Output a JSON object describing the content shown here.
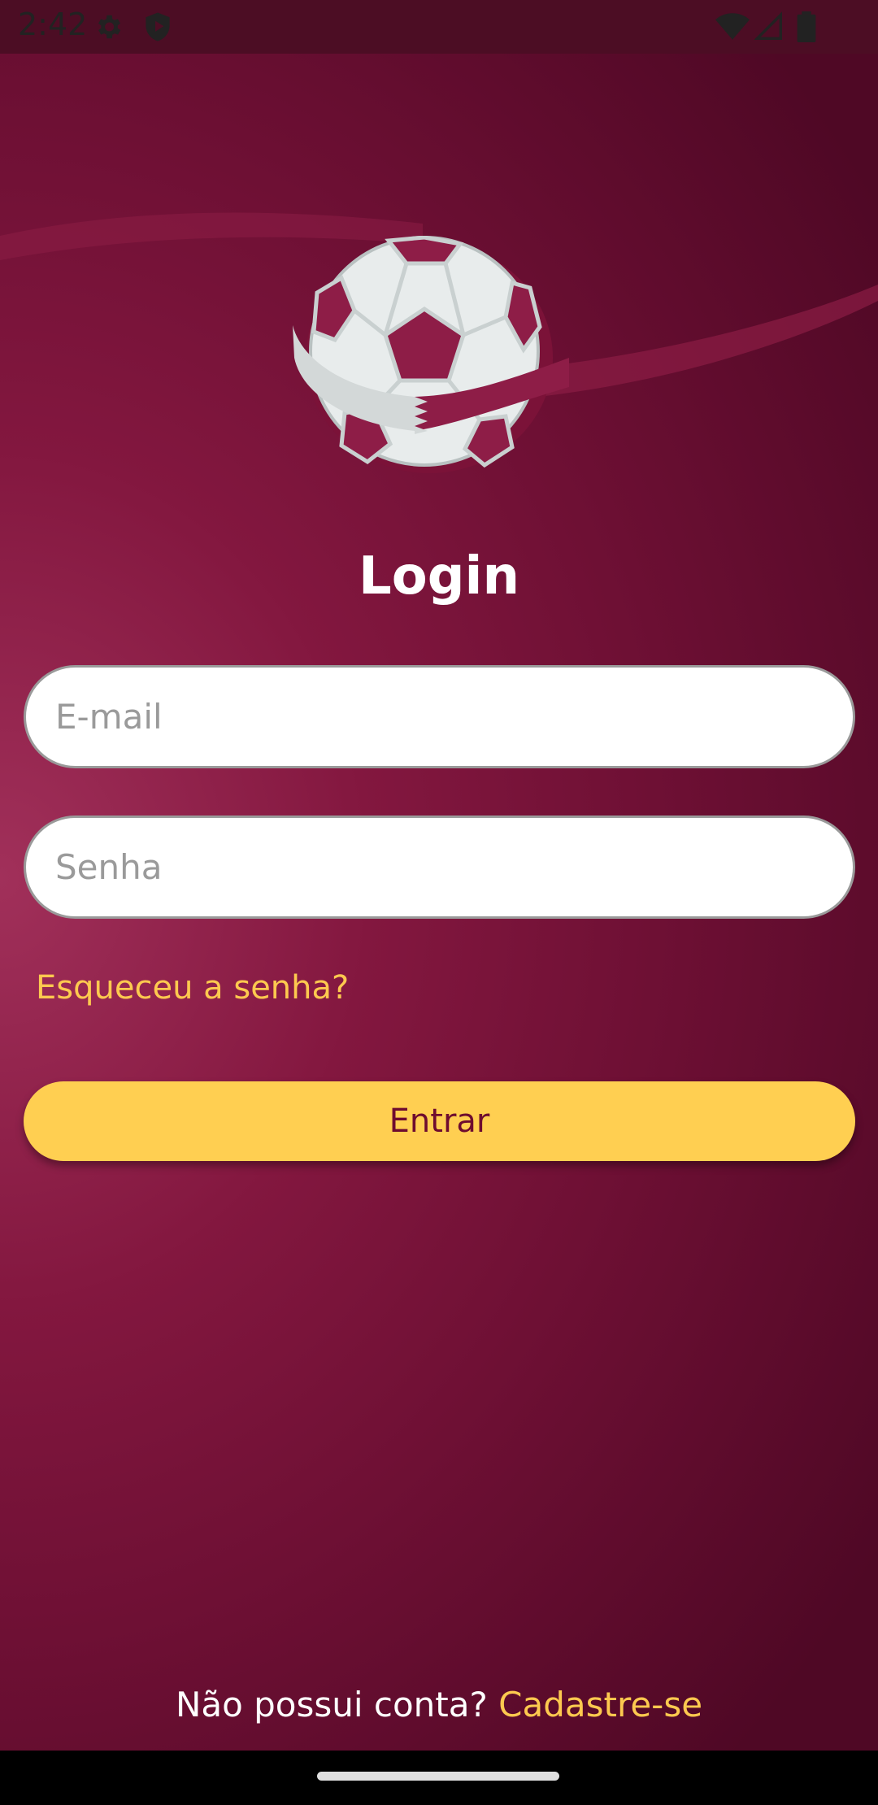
{
  "status_bar": {
    "time": "2:42",
    "icons": [
      "gear-icon",
      "shield-icon",
      "wifi-icon",
      "signal-icon",
      "battery-icon"
    ]
  },
  "colors": {
    "background_dark": "#4f0825",
    "background_mid": "#83173f",
    "accent_yellow": "#ffcf51",
    "link_yellow": "#fdc94f",
    "button_text": "#6e0c2f"
  },
  "logo": {
    "icon": "soccer-ball-logo-icon"
  },
  "login": {
    "title": "Login",
    "email_placeholder": "E-mail",
    "password_placeholder": "Senha",
    "forgot_password": "Esqueceu a senha?",
    "enter_button": "Entrar"
  },
  "footer": {
    "no_account_text": "Não possui conta?",
    "signup_link": "Cadastre-se"
  }
}
